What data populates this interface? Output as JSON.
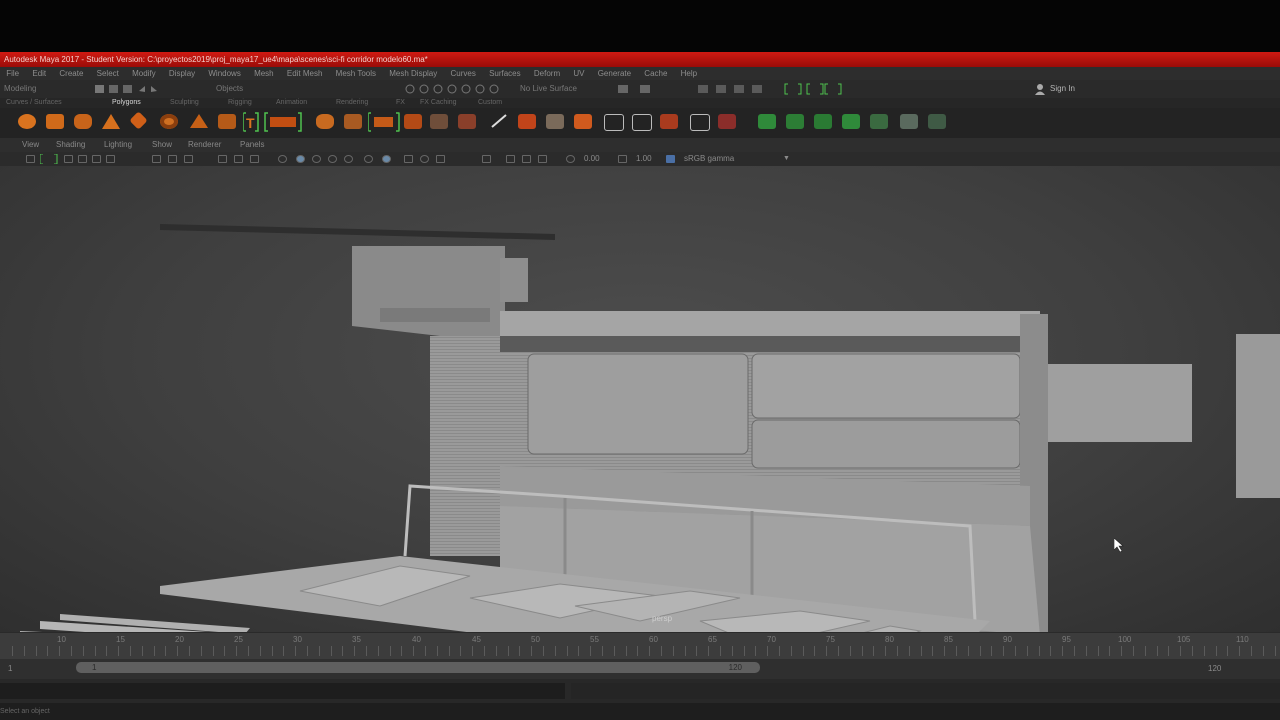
{
  "window": {
    "title": "Autodesk Maya 2017 - Student Version: C:\\proyectos2019\\proj_maya17_ue4\\mapa\\scenes\\sci-fi corridor modelo60.ma*"
  },
  "menu": [
    "File",
    "Edit",
    "Create",
    "Select",
    "Modify",
    "Display",
    "Windows",
    "Mesh",
    "Edit Mesh",
    "Mesh Tools",
    "Mesh Display",
    "Curves",
    "Surfaces",
    "Deform",
    "UV",
    "Generate",
    "Cache",
    "Help"
  ],
  "status_line": {
    "mode": "Modeling",
    "objects_label": "Objects",
    "live_surface": "No Live Surface",
    "sign_in": "Sign In"
  },
  "shelf": {
    "active_tab": "Polygons",
    "tabs": [
      "Curves / Surfaces",
      "Polygons",
      "Sculpting",
      "Rigging",
      "Animation",
      "Rendering",
      "FX",
      "FX Caching",
      "Custom"
    ]
  },
  "panel_menu": [
    "View",
    "Shading",
    "Lighting",
    "Show",
    "Renderer",
    "Panels"
  ],
  "panel_toolbar": {
    "exposure": "0.00",
    "gamma": "1.00",
    "color_space": "sRGB gamma"
  },
  "viewport": {
    "camera_label": "persp"
  },
  "timeline": {
    "ticks": [
      "10",
      "15",
      "20",
      "25",
      "30",
      "35",
      "40",
      "45",
      "50",
      "55",
      "60",
      "65",
      "70",
      "75",
      "80",
      "85",
      "90",
      "95",
      "100",
      "105",
      "110"
    ]
  },
  "range": {
    "start": "1",
    "track_start": "1",
    "track_end": "120",
    "end": "120"
  },
  "help_line": "Select an object",
  "colors": {
    "title_bar": "#c0150e",
    "shelf_orange": "#d9731f",
    "shelf_green": "#3fa33f",
    "viewport_bg": "#454545"
  }
}
